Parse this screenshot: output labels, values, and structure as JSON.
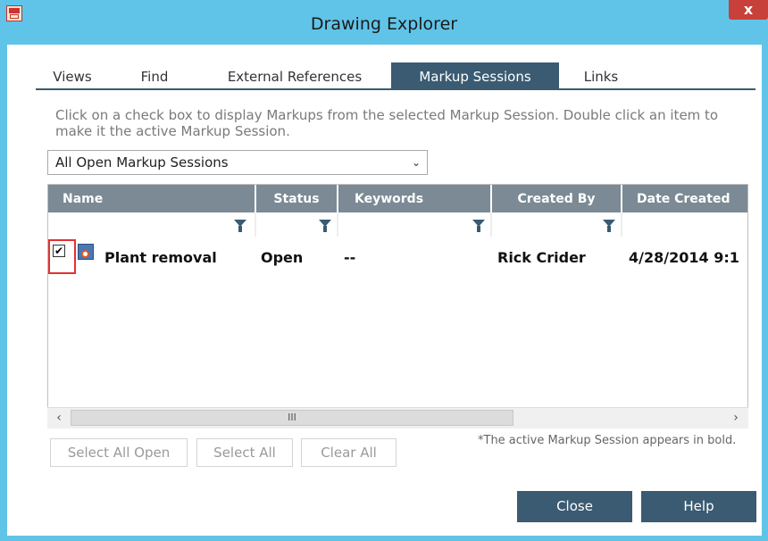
{
  "window": {
    "title": "Drawing Explorer",
    "close_symbol": "x"
  },
  "tabs": [
    {
      "label": "Views",
      "active": false
    },
    {
      "label": "Find",
      "active": false
    },
    {
      "label": "External References",
      "active": false
    },
    {
      "label": "Markup Sessions",
      "active": true
    },
    {
      "label": "Links",
      "active": false
    }
  ],
  "instructions": "Click on a check box to display Markups from the selected Markup Session. Double click an item to make it the active Markup Session.",
  "session_filter": {
    "selected": "All Open Markup Sessions"
  },
  "grid": {
    "columns": [
      "Name",
      "Status",
      "Keywords",
      "Created By",
      "Date Created"
    ],
    "rows": [
      {
        "checked": true,
        "name": "Plant removal",
        "status": "Open",
        "keywords": "--",
        "created_by": "Rick Crider",
        "date_created": "4/28/2014 9:1"
      }
    ],
    "scroll_thumb_label": "III"
  },
  "buttons": {
    "select_all_open": "Select All Open",
    "select_all": "Select All",
    "clear_all": "Clear All",
    "close": "Close",
    "help": "Help"
  },
  "note": "*The active Markup Session appears in bold.",
  "colors": {
    "titlebar": "#60c4e8",
    "accent": "#3a5b72",
    "header": "#7b8a94",
    "highlight": "#e53030"
  }
}
